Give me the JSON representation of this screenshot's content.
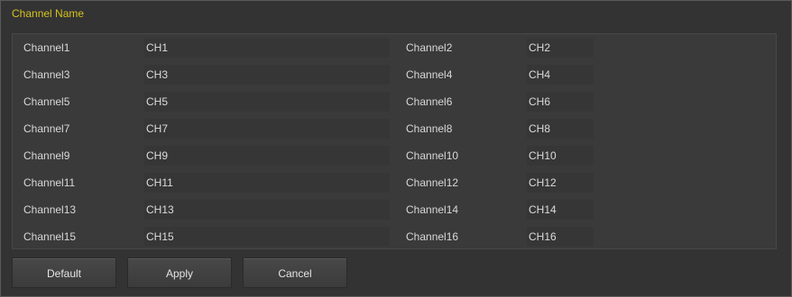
{
  "title": "Channel Name",
  "rows": [
    {
      "left_label": "Channel1",
      "left_value": "CH1",
      "right_label": "Channel2",
      "right_value": "CH2"
    },
    {
      "left_label": "Channel3",
      "left_value": "CH3",
      "right_label": "Channel4",
      "right_value": "CH4"
    },
    {
      "left_label": "Channel5",
      "left_value": "CH5",
      "right_label": "Channel6",
      "right_value": "CH6"
    },
    {
      "left_label": "Channel7",
      "left_value": "CH7",
      "right_label": "Channel8",
      "right_value": "CH8"
    },
    {
      "left_label": "Channel9",
      "left_value": "CH9",
      "right_label": "Channel10",
      "right_value": "CH10"
    },
    {
      "left_label": "Channel11",
      "left_value": "CH11",
      "right_label": "Channel12",
      "right_value": "CH12"
    },
    {
      "left_label": "Channel13",
      "left_value": "CH13",
      "right_label": "Channel14",
      "right_value": "CH14"
    },
    {
      "left_label": "Channel15",
      "left_value": "CH15",
      "right_label": "Channel16",
      "right_value": "CH16"
    }
  ],
  "buttons": {
    "default_label": "Default",
    "apply_label": "Apply",
    "cancel_label": "Cancel"
  },
  "colors": {
    "title": "#d4c21e",
    "background": "#333333",
    "text": "#d8d8d8"
  }
}
